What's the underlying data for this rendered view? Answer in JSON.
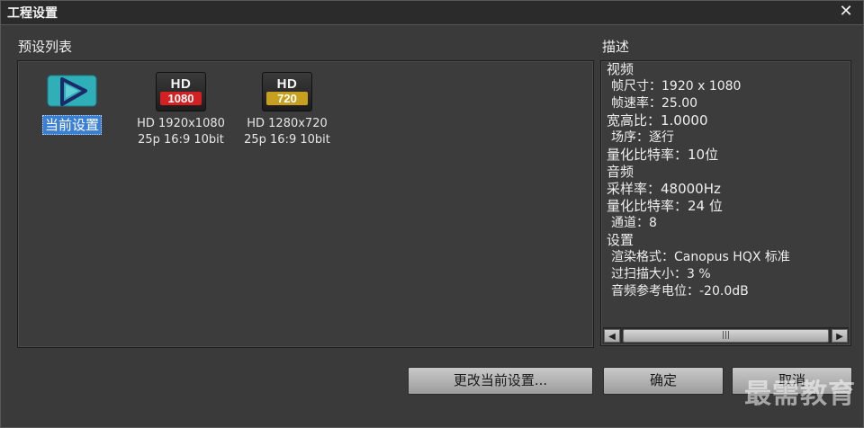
{
  "window": {
    "title": "工程设置",
    "close_glyph": "✕"
  },
  "presets": {
    "label": "预设列表",
    "items": [
      {
        "icon": "current-settings-icon",
        "name": "当前设置",
        "selected": true
      },
      {
        "icon": "hd-1080-icon",
        "badge_top": "HD",
        "badge_res": "1080",
        "badge_color": "#d42020",
        "line1": "HD 1920x1080",
        "line2": "25p 16:9 10bit"
      },
      {
        "icon": "hd-720-icon",
        "badge_top": "HD",
        "badge_res": "720",
        "badge_color": "#c8a020",
        "line1": "HD 1280x720",
        "line2": "25p 16:9 10bit"
      }
    ]
  },
  "description": {
    "label": "描述",
    "lines": [
      {
        "text": "视频",
        "indent": false
      },
      {
        "text": "帧尺寸：1920 x 1080",
        "indent": true
      },
      {
        "text": "帧速率：25.00",
        "indent": true
      },
      {
        "text": "宽高比：1.0000",
        "indent": false
      },
      {
        "text": "场序：逐行",
        "indent": true
      },
      {
        "text": "量化比特率：10位",
        "indent": false
      },
      {
        "text": "音频",
        "indent": false
      },
      {
        "text": "采样率：48000Hz",
        "indent": false
      },
      {
        "text": "量化比特率：24 位",
        "indent": false
      },
      {
        "text": "通道：8",
        "indent": true
      },
      {
        "text": "设置",
        "indent": false
      },
      {
        "text": "渲染格式：Canopus HQX 标准",
        "indent": true
      },
      {
        "text": "过扫描大小：3 %",
        "indent": true
      },
      {
        "text": "音频参考电位：-20.0dB",
        "indent": true
      }
    ],
    "scroll_left": "◀",
    "scroll_right": "▶",
    "scroll_grip": "|||"
  },
  "buttons": {
    "change": "更改当前设置...",
    "ok": "确定",
    "cancel": "取消"
  },
  "watermark": "最需教育",
  "colors": {
    "selection": "#3a7fd6",
    "accent_teal": "#2fb0b8"
  }
}
